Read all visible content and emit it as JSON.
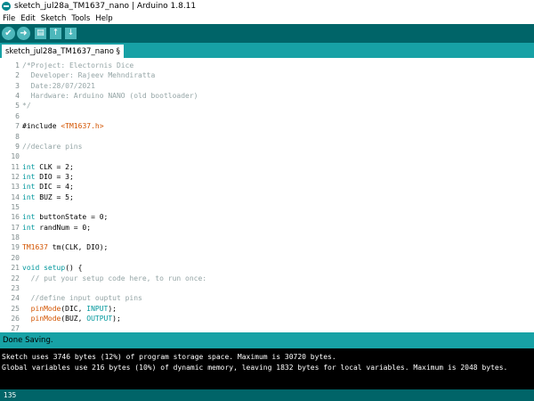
{
  "window": {
    "title": "sketch_jul28a_TM1637_nano | Arduino 1.8.11"
  },
  "menu": [
    "File",
    "Edit",
    "Sketch",
    "Tools",
    "Help"
  ],
  "toolbar": {
    "buttons": [
      {
        "icon": "checkmark-icon",
        "glyph": "✔"
      },
      {
        "icon": "arrow-right-icon",
        "glyph": "➜"
      },
      {
        "icon": "new-file-icon",
        "glyph": "▤"
      },
      {
        "icon": "upload-arrow-icon",
        "glyph": "↑"
      },
      {
        "icon": "download-arrow-icon",
        "glyph": "↓"
      }
    ]
  },
  "tab": {
    "label": "sketch_jul28a_TM1637_nano §"
  },
  "editor": {
    "line_numbers": [
      "1",
      "2",
      "3",
      "4",
      "5",
      "6",
      "7",
      "8",
      "9",
      "10",
      "11",
      "12",
      "13",
      "14",
      "15",
      "16",
      "17",
      "18",
      "19",
      "20",
      "21",
      "22",
      "23",
      "24",
      "25",
      "26",
      "27"
    ],
    "lines": [
      [
        {
          "t": "/*Project: Electornis Dice",
          "c": "cmt"
        }
      ],
      [
        {
          "t": "  Developer: Rajeev Mehndiratta",
          "c": "cmt"
        }
      ],
      [
        {
          "t": "  Date:28/07/2021",
          "c": "cmt"
        }
      ],
      [
        {
          "t": "  Hardware: Arduino NANO (old bootloader)",
          "c": "cmt"
        }
      ],
      [
        {
          "t": "*/",
          "c": "cmt"
        }
      ],
      [],
      [
        {
          "t": "#include ",
          "c": ""
        },
        {
          "t": "<TM1637.h>",
          "c": "fn"
        }
      ],
      [],
      [
        {
          "t": "//declare pins",
          "c": "cmt"
        }
      ],
      [],
      [
        {
          "t": "int",
          "c": "kw"
        },
        {
          "t": " CLK = 2;",
          "c": ""
        }
      ],
      [
        {
          "t": "int",
          "c": "kw"
        },
        {
          "t": " DIO = 3;",
          "c": ""
        }
      ],
      [
        {
          "t": "int",
          "c": "kw"
        },
        {
          "t": " DIC = 4;",
          "c": ""
        }
      ],
      [
        {
          "t": "int",
          "c": "kw"
        },
        {
          "t": " BUZ = 5;",
          "c": ""
        }
      ],
      [],
      [
        {
          "t": "int",
          "c": "kw"
        },
        {
          "t": " buttonState = 0;",
          "c": ""
        }
      ],
      [
        {
          "t": "int",
          "c": "kw"
        },
        {
          "t": " randNum = 0;",
          "c": ""
        }
      ],
      [],
      [
        {
          "t": "TM1637",
          "c": "ty"
        },
        {
          "t": " tm(CLK, DIO);",
          "c": ""
        }
      ],
      [],
      [
        {
          "t": "void",
          "c": "kw"
        },
        {
          "t": " ",
          "c": ""
        },
        {
          "t": "setup",
          "c": "kw"
        },
        {
          "t": "() {",
          "c": ""
        }
      ],
      [
        {
          "t": "  // put your setup code here, to run once:",
          "c": "cmt"
        }
      ],
      [],
      [
        {
          "t": "  //define input ouptut pins",
          "c": "cmt"
        }
      ],
      [
        {
          "t": "  ",
          "c": ""
        },
        {
          "t": "pinMode",
          "c": "fn"
        },
        {
          "t": "(DIC, ",
          "c": ""
        },
        {
          "t": "INPUT",
          "c": "kw"
        },
        {
          "t": ");",
          "c": ""
        }
      ],
      [
        {
          "t": "  ",
          "c": ""
        },
        {
          "t": "pinMode",
          "c": "fn"
        },
        {
          "t": "(BUZ, ",
          "c": ""
        },
        {
          "t": "OUTPUT",
          "c": "kw"
        },
        {
          "t": ");",
          "c": ""
        }
      ],
      []
    ]
  },
  "status": {
    "text": "Done Saving."
  },
  "console": {
    "lines": [
      "Sketch uses 3746 bytes (12%) of program storage space. Maximum is 30720 bytes.",
      "Global variables use 216 bytes (10%) of dynamic memory, leaving 1832 bytes for local variables. Maximum is 2048 bytes."
    ]
  },
  "bottom": {
    "line_indicator": "135"
  },
  "colors": {
    "toolbar_bg": "#006468",
    "tabbar_bg": "#17a1a5",
    "button_bg": "#4db7bb",
    "comment": "#95a5a6",
    "keyword": "#00979c",
    "function": "#d35400"
  }
}
